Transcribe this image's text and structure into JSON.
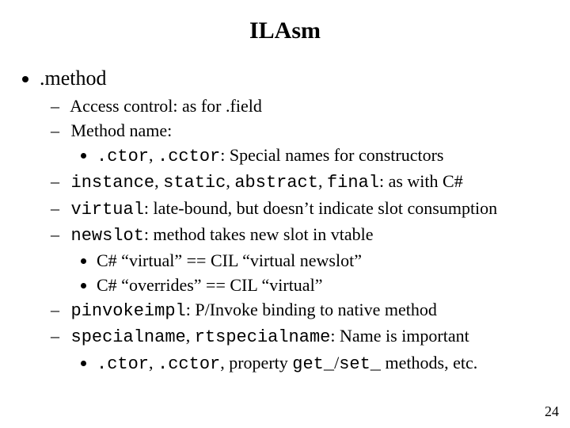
{
  "title": "ILAsm",
  "page_number": "24",
  "method": {
    "label": ".method",
    "access_control": "Access control: as for .field",
    "method_name": "Method name:",
    "ctor": {
      "code1": ".ctor",
      "sep": ", ",
      "code2": ".cctor",
      "after": ": Special names for constructors"
    },
    "instance": {
      "c1": "instance",
      "s1": ", ",
      "c2": "static",
      "s2": ", ",
      "c3": "abstract",
      "s3": ", ",
      "c4": "final",
      "after": ": as with C#"
    },
    "virtual": {
      "code": "virtual",
      "after": ": late-bound, but doesn’t indicate slot consumption"
    },
    "newslot": {
      "code": "newslot",
      "after": ": method takes new slot in vtable",
      "sub1": "C# “virtual” == CIL “virtual newslot”",
      "sub2": "C# “overrides” == CIL “virtual”"
    },
    "pinvoke": {
      "code": "pinvokeimpl",
      "after": ": P/Invoke binding to native method"
    },
    "special": {
      "c1": "specialname",
      "s1": ", ",
      "c2": "rtspecialname",
      "after": ": Name is important",
      "sub": {
        "c1": ".ctor",
        "s1": ", ",
        "c2": ".cctor",
        "s2": ", property ",
        "c3": "get_",
        "s3": "/",
        "c4": "set_",
        "after": " methods, etc."
      }
    }
  }
}
